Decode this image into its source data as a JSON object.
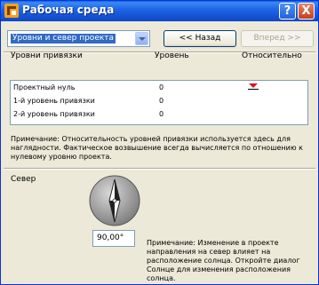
{
  "window": {
    "title": "Рабочая среда",
    "help_label": "?",
    "close_label": "X"
  },
  "toolbar": {
    "dropdown_value": "Уровни и север проекта",
    "back_label": "<< Назад",
    "forward_label": "Вперед >>"
  },
  "levels": {
    "headers": {
      "name": "Уровни привязки",
      "level": "Уровень",
      "relative": "Относительно"
    },
    "rows": [
      {
        "name": "Проектный нуль",
        "value": "0",
        "relative": true
      },
      {
        "name": "1-й уровень привязки",
        "value": "0",
        "relative": false
      },
      {
        "name": "2-й уровень привязки",
        "value": "0",
        "relative": false
      }
    ],
    "note": "Примечание: Относительность уровней привязки используется здесь для наглядности. Фактическое возвышение всегда вычисляется по отношению к нулевому уровню проекта."
  },
  "north": {
    "label": "Север",
    "angle_value": "90,00°",
    "note": "Примечание: Изменение в проекте направления на север влияет на расположение солнца. Откройте диалог Солнце для изменения расположения солнца."
  },
  "colors": {
    "titlebar": "#1f66e6",
    "marker": "#e0101a",
    "selection": "#316ac5"
  }
}
